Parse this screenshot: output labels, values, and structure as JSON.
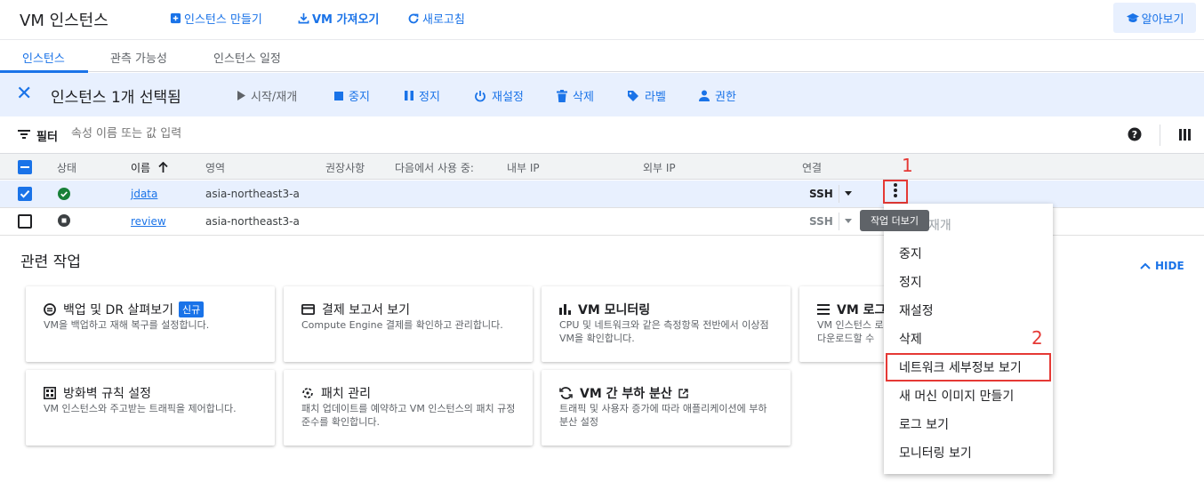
{
  "header": {
    "title": "VM 인스턴스",
    "actions": [
      {
        "label": "인스턴스 만들기",
        "icon": "add-box-icon"
      },
      {
        "label": "VM 가져오기",
        "icon": "download-icon"
      },
      {
        "label": "새로고침",
        "icon": "refresh-icon"
      }
    ],
    "learn_label": "알아보기"
  },
  "tabs": [
    "인스턴스",
    "관측 가능성",
    "인스턴스 일정"
  ],
  "selection_bar": {
    "count_label": "인스턴스 1개 선택됨",
    "actions": [
      {
        "label": "시작/재개",
        "icon": "play-icon",
        "enabled": false
      },
      {
        "label": "중지",
        "icon": "stop-icon",
        "enabled": true
      },
      {
        "label": "정지",
        "icon": "pause-icon",
        "enabled": true
      },
      {
        "label": "재설정",
        "icon": "power-icon",
        "enabled": true
      },
      {
        "label": "삭제",
        "icon": "trash-icon",
        "enabled": true
      },
      {
        "label": "라벨",
        "icon": "label-icon",
        "enabled": true
      },
      {
        "label": "권한",
        "icon": "person-icon",
        "enabled": true
      }
    ]
  },
  "filter": {
    "label": "필터",
    "placeholder": "속성 이름 또는 값 입력"
  },
  "table": {
    "headers": [
      "상태",
      "이름",
      "영역",
      "권장사항",
      "다음에서 사용 중:",
      "내부 IP",
      "외부 IP",
      "연결"
    ],
    "rows": [
      {
        "status": "running",
        "name": "jdata",
        "zone": "asia-northeast3-a",
        "connect": "SSH",
        "selected": true
      },
      {
        "status": "stopped",
        "name": "review",
        "zone": "asia-northeast3-a",
        "connect": "SSH",
        "selected": false
      }
    ]
  },
  "tooltip": "작업 더보기",
  "menu": {
    "items": [
      {
        "label": "재개",
        "enabled": false
      },
      {
        "label": "중지",
        "enabled": true
      },
      {
        "label": "정지",
        "enabled": true
      },
      {
        "label": "재설정",
        "enabled": true
      },
      {
        "label": "삭제",
        "enabled": true
      },
      {
        "label": "네트워크 세부정보 보기",
        "enabled": true,
        "highlighted": true
      },
      {
        "label": "새 머신 이미지 만들기",
        "enabled": true
      },
      {
        "label": "로그 보기",
        "enabled": true
      },
      {
        "label": "모니터링 보기",
        "enabled": true
      }
    ]
  },
  "annotations": [
    "1",
    "2"
  ],
  "related": {
    "title": "관련 작업",
    "hide_label": "HIDE",
    "cards": [
      {
        "title": "백업 및 DR 살펴보기",
        "badge": "신규",
        "desc": "VM을 백업하고 재해 복구를 설정합니다.",
        "icon": "backup-icon"
      },
      {
        "title": "결제 보고서 보기",
        "desc": "Compute Engine 결제를 확인하고 관리합니다.",
        "icon": "billing-icon"
      },
      {
        "title": "VM 모니터링",
        "desc": "CPU 및 네트워크와 같은 측정항목 전반에서 이상점 VM을 확인합니다.",
        "icon": "bar-chart-icon"
      },
      {
        "title": "VM 로그",
        "desc": "VM 인스턴스 로그를 다운로드할 수",
        "icon": "logs-icon"
      },
      {
        "title": "방화벽 규칙 설정",
        "desc": "VM 인스턴스와 주고받는 트래픽을 제어합니다.",
        "icon": "firewall-icon"
      },
      {
        "title": "패치 관리",
        "desc": "패치 업데이트를 예약하고 VM 인스턴스의 패치 규정 준수를 확인합니다.",
        "icon": "patch-icon"
      },
      {
        "title": "VM 간 부하 분산",
        "desc": "트래픽 및 사용자 증가에 따라 애플리케이션에 부하 분산 설정",
        "icon": "load-balance-icon"
      }
    ]
  },
  "colors": {
    "accent": "#1a73e8",
    "highlight": "#e53935",
    "running": "#188038"
  }
}
